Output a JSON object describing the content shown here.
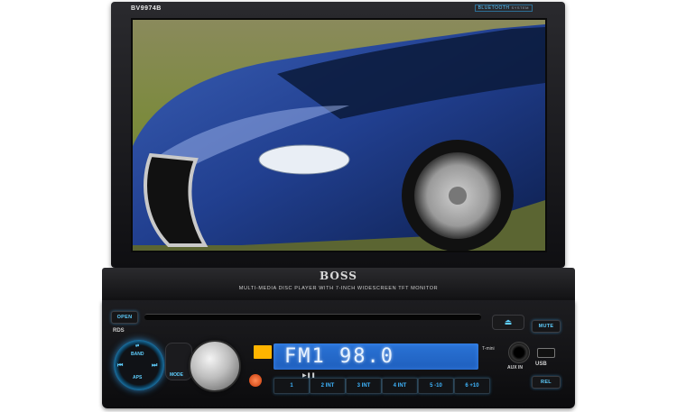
{
  "model": "BV9974B",
  "bluetooth_badge": {
    "label": "BLUETOOTH",
    "sublabel": "SYSTEM"
  },
  "brand": "BOSS",
  "tagline": "MULTI-MEDIA DISC PLAYER WITH 7-INCH WIDESCREEN TFT MONITOR",
  "buttons": {
    "open": "OPEN",
    "mute": "MUTE",
    "rel": "REL",
    "eject": "⏏",
    "mode": "MODE"
  },
  "rds": "RDS",
  "nav_dial": {
    "top": "⇄",
    "band": "BAND",
    "prev": "⏮",
    "next": "⏭",
    "aps": "APS"
  },
  "display": {
    "text": "FM1 98.0"
  },
  "presets": [
    "1",
    "2 INT",
    "3 INT",
    "4 INT",
    "5 -10",
    "6 +10"
  ],
  "play_pause": "▶❚❚",
  "aux_label": "AUX IN",
  "usb_label": "USB",
  "tmini_label": "T-mini",
  "colors": {
    "accent_blue": "#3fb6ff",
    "lcd_blue": "#2a73d6",
    "body": "#121214",
    "power": "#ff5a1f"
  },
  "icons": [
    "eject-icon",
    "power-icon",
    "aux-jack-icon",
    "usb-icon",
    "play-pause-icon"
  ]
}
